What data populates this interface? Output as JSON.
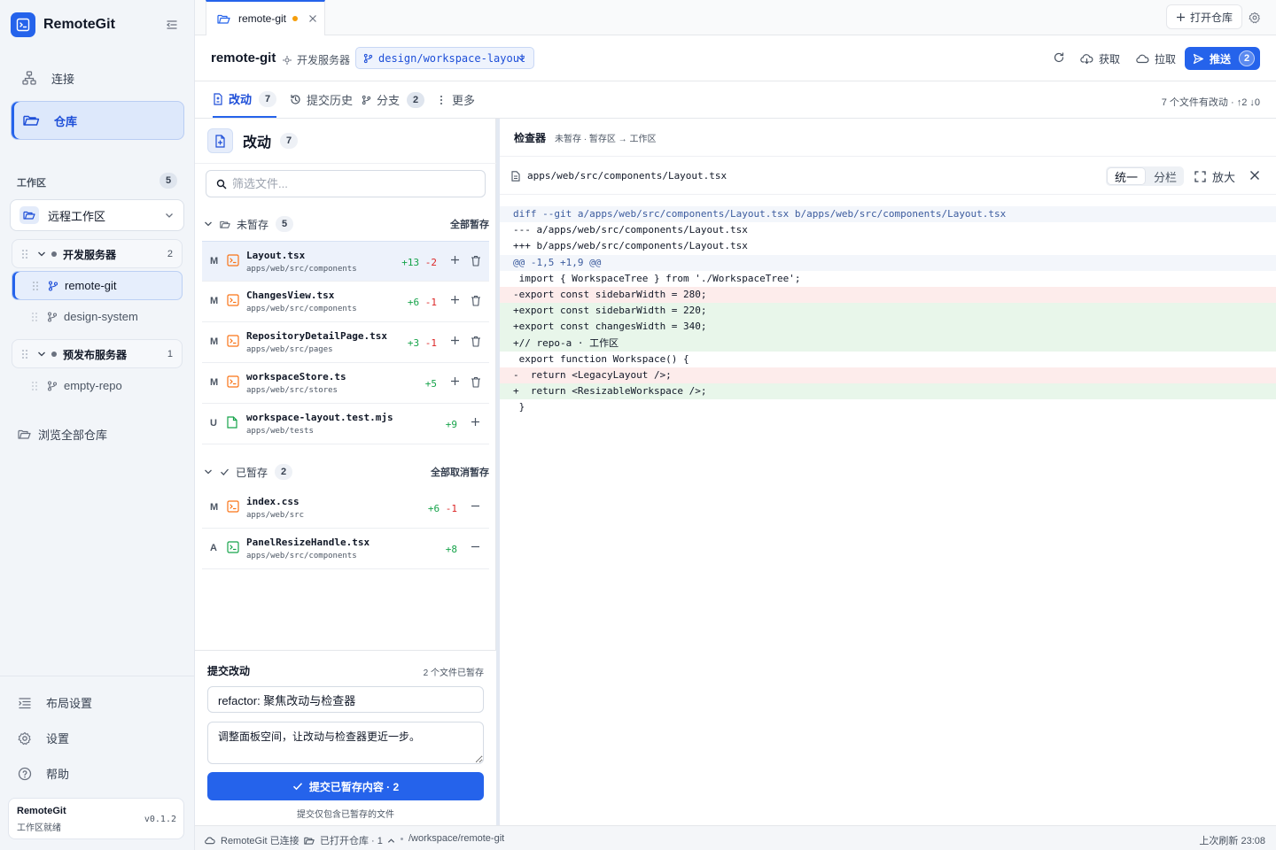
{
  "app": {
    "name": "RemoteGit",
    "version": "v0.1.2",
    "status": "工作区就绪"
  },
  "sidebar": {
    "nav": {
      "connect": "连接",
      "repos": "仓库"
    },
    "workspace_label": "工作区",
    "workspace_count": "5",
    "workspace_select": "远程工作区",
    "servers": [
      {
        "name": "开发服务器",
        "count": "2",
        "repos": [
          "remote-git",
          "design-system"
        ]
      },
      {
        "name": "预发布服务器",
        "count": "1",
        "repos": [
          "empty-repo"
        ]
      }
    ],
    "browse_all": "浏览全部仓库",
    "footer": {
      "layout": "布局设置",
      "settings": "设置",
      "help": "帮助"
    }
  },
  "topbar": {
    "tab_label": "remote-git",
    "open_repo": "打开仓库"
  },
  "repo_header": {
    "title": "remote-git",
    "server": "开发服务器",
    "branch": "design/workspace-layout",
    "actions": {
      "fetch": "获取",
      "pull": "拉取",
      "push": "推送",
      "push_count": "2"
    }
  },
  "subtabs": {
    "changes": "改动",
    "changes_count": "7",
    "history": "提交历史",
    "branches": "分支",
    "branches_count": "2",
    "more": "更多",
    "summary": "7 个文件有改动 · ↑2 ↓0"
  },
  "changes": {
    "title": "改动",
    "count": "7",
    "filter_placeholder": "筛选文件...",
    "unstaged": {
      "label": "未暂存",
      "count": "5",
      "action": "全部暂存",
      "files": [
        {
          "status": "M",
          "name": "Layout.tsx",
          "path": "apps/web/src/components",
          "add": "+13",
          "del": "-2"
        },
        {
          "status": "M",
          "name": "ChangesView.tsx",
          "path": "apps/web/src/components",
          "add": "+6",
          "del": "-1"
        },
        {
          "status": "M",
          "name": "RepositoryDetailPage.tsx",
          "path": "apps/web/src/pages",
          "add": "+3",
          "del": "-1"
        },
        {
          "status": "M",
          "name": "workspaceStore.ts",
          "path": "apps/web/src/stores",
          "add": "+5",
          "del": ""
        },
        {
          "status": "U",
          "name": "workspace-layout.test.mjs",
          "path": "apps/web/tests",
          "add": "+9",
          "del": ""
        }
      ]
    },
    "staged": {
      "label": "已暂存",
      "count": "2",
      "action": "全部取消暂存",
      "files": [
        {
          "status": "M",
          "name": "index.css",
          "path": "apps/web/src",
          "add": "+6",
          "del": "-1"
        },
        {
          "status": "A",
          "name": "PanelResizeHandle.tsx",
          "path": "apps/web/src/components",
          "add": "+8",
          "del": ""
        }
      ]
    }
  },
  "commit": {
    "title": "提交改动",
    "staged_info": "2 个文件已暂存",
    "summary": "refactor: 聚焦改动与检查器",
    "description": "调整面板空间，让改动与检查器更近一步。",
    "button": "提交已暂存内容 · 2",
    "hint": "提交仅包含已暂存的文件"
  },
  "inspector": {
    "title": "检查器",
    "subtitle": "未暂存 · 暂存区 → 工作区",
    "file_path": "apps/web/src/components/Layout.tsx",
    "view_unified": "统一",
    "view_split": "分栏",
    "zoom": "放大",
    "diff": [
      {
        "type": "meta",
        "text": "diff --git a/apps/web/src/components/Layout.tsx b/apps/web/src/components/Layout.tsx"
      },
      {
        "type": "context",
        "text": "--- a/apps/web/src/components/Layout.tsx"
      },
      {
        "type": "context",
        "text": "+++ b/apps/web/src/components/Layout.tsx"
      },
      {
        "type": "hunk",
        "text": "@@ -1,5 +1,9 @@"
      },
      {
        "type": "context",
        "text": " import { WorkspaceTree } from './WorkspaceTree';"
      },
      {
        "type": "removed",
        "text": "-export const sidebarWidth = 280;"
      },
      {
        "type": "added",
        "text": "+export const sidebarWidth = 220;"
      },
      {
        "type": "added",
        "text": "+export const changesWidth = 340;"
      },
      {
        "type": "added",
        "text": "+// repo-a · 工作区"
      },
      {
        "type": "context",
        "text": " export function Workspace() {"
      },
      {
        "type": "removed",
        "text": "-  return <LegacyLayout />;"
      },
      {
        "type": "added",
        "text": "+  return <ResizableWorkspace />;"
      },
      {
        "type": "context",
        "text": " }"
      }
    ]
  },
  "statusbar": {
    "connection": "RemoteGit 已连接",
    "open_repos": "已打开仓库 · 1",
    "path": "/workspace/remote-git",
    "refresh": "上次刷新 23:08"
  },
  "colors": {
    "accent": "#2563eb",
    "added": "#16a34a",
    "removed": "#dc2626",
    "dirty": "#f59e0b"
  }
}
